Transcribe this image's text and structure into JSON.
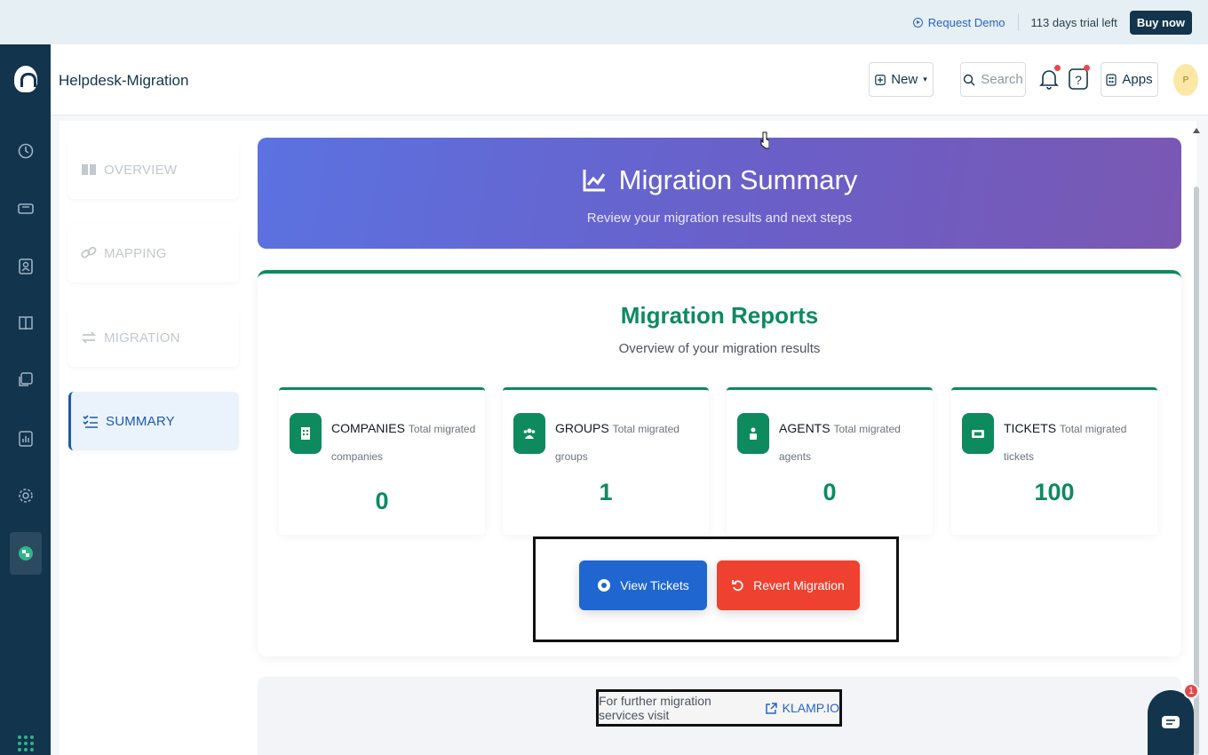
{
  "trial_bar": {
    "request_demo": "Request Demo",
    "trial_left": "113 days trial left",
    "buy_now": "Buy now"
  },
  "header": {
    "title": "Helpdesk-Migration",
    "new_label": "New",
    "search_placeholder": "Search",
    "apps_label": "Apps",
    "avatar_initial": "P"
  },
  "steps": [
    {
      "label": "OVERVIEW",
      "icon": "book-icon",
      "active": false
    },
    {
      "label": "MAPPING",
      "icon": "link-icon",
      "active": false
    },
    {
      "label": "MIGRATION",
      "icon": "swap-icon",
      "active": false
    },
    {
      "label": "SUMMARY",
      "icon": "checklist-icon",
      "active": true
    }
  ],
  "hero": {
    "title": "Migration Summary",
    "subtitle": "Review your migration results and next steps"
  },
  "reports": {
    "title": "Migration Reports",
    "subtitle": "Overview of your migration results",
    "cards": [
      {
        "name": "COMPANIES",
        "desc": "Total migrated companies",
        "value": "0",
        "icon": "building-icon"
      },
      {
        "name": "GROUPS",
        "desc": "Total migrated groups",
        "value": "1",
        "icon": "users-icon"
      },
      {
        "name": "AGENTS",
        "desc": "Total migrated agents",
        "value": "0",
        "icon": "agent-icon"
      },
      {
        "name": "TICKETS",
        "desc": "Total migrated tickets",
        "value": "100",
        "icon": "ticket-icon"
      }
    ],
    "view_tickets": "View Tickets",
    "revert_migration": "Revert Migration"
  },
  "footer": {
    "text": "For further migration services visit",
    "link": "KLAMP.IO"
  },
  "chat": {
    "badge": "1"
  },
  "colors": {
    "nav_bg": "#12344d",
    "accent_green": "#0e8a5f",
    "view_blue": "#1f66d1",
    "revert_red": "#ef4130",
    "hero_start": "#5b72e0",
    "hero_end": "#7a58b2"
  }
}
